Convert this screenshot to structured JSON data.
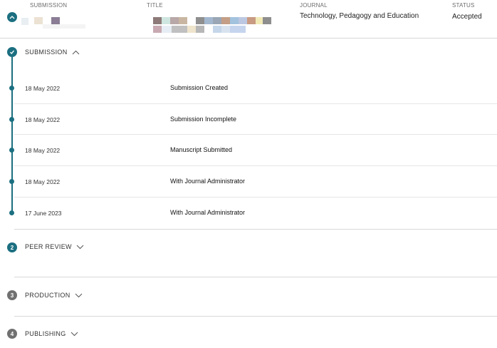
{
  "header": {
    "columns": {
      "submission": "SUBMISSION",
      "title": "TITLE",
      "journal": "JOURNAL",
      "status": "STATUS"
    },
    "journal_value": "Technology, Pedagogy and Education",
    "status_value": "Accepted"
  },
  "stages": [
    {
      "label": "SUBMISSION",
      "icon": "check-icon",
      "state": "completed",
      "expanded": true
    },
    {
      "label": "PEER REVIEW",
      "number": "2",
      "state": "current",
      "expanded": false
    },
    {
      "label": "PRODUCTION",
      "number": "3",
      "state": "pending",
      "expanded": false
    },
    {
      "label": "PUBLISHING",
      "number": "4",
      "state": "pending",
      "expanded": false
    }
  ],
  "events": [
    {
      "date": "18 May 2022",
      "name": "Submission Created"
    },
    {
      "date": "18 May 2022",
      "name": "Submission Incomplete"
    },
    {
      "date": "18 May 2022",
      "name": "Manuscript Submitted"
    },
    {
      "date": "18 May 2022",
      "name": "With Journal Administrator"
    },
    {
      "date": "17 June 2023",
      "name": "With Journal Administrator"
    }
  ],
  "colors": {
    "accent": "#1b6f80",
    "pending": "#707070"
  }
}
